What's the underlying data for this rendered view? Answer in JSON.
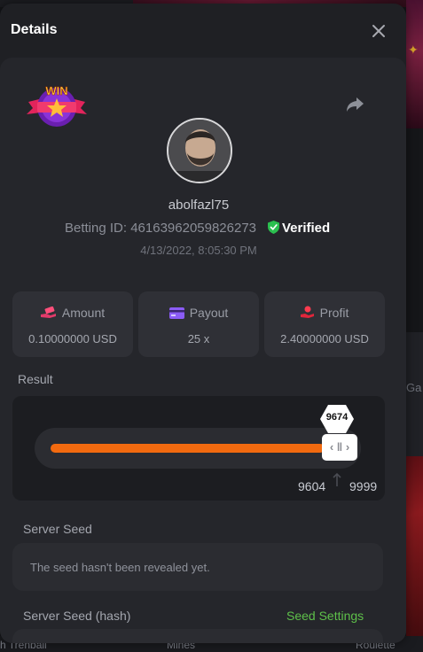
{
  "modal": {
    "title": "Details",
    "user": {
      "username": "abolfazl75",
      "betting_id_label": "Betting ID: 46163962059826273",
      "verified_label": "Verified",
      "timestamp": "4/13/2022, 8:05:30 PM"
    },
    "badge_text": "WIN",
    "stats": [
      {
        "label": "Amount",
        "value": "0.10000000 USD",
        "icon": "money-hand-icon"
      },
      {
        "label": "Payout",
        "value": "25 x",
        "icon": "card-icon"
      },
      {
        "label": "Profit",
        "value": "2.40000000 USD",
        "icon": "profit-hand-icon"
      }
    ],
    "result": {
      "label": "Result",
      "value": "9674",
      "range_min": "9604",
      "range_max": "9999",
      "fill_fraction": 0.84
    },
    "server_seed": {
      "label": "Server Seed",
      "text": "The seed hasn't been revealed yet."
    },
    "server_seed_hash": {
      "label": "Server Seed (hash)",
      "settings_link": "Seed Settings"
    },
    "colors": {
      "accent_orange": "#f26a0f",
      "verified_green": "#2bbf4f",
      "link_green": "#5ec04a"
    }
  },
  "background": {
    "bottom_labels": [
      "h Trenball",
      "Mines",
      "Roulette"
    ],
    "right_fragment": "Ga"
  }
}
